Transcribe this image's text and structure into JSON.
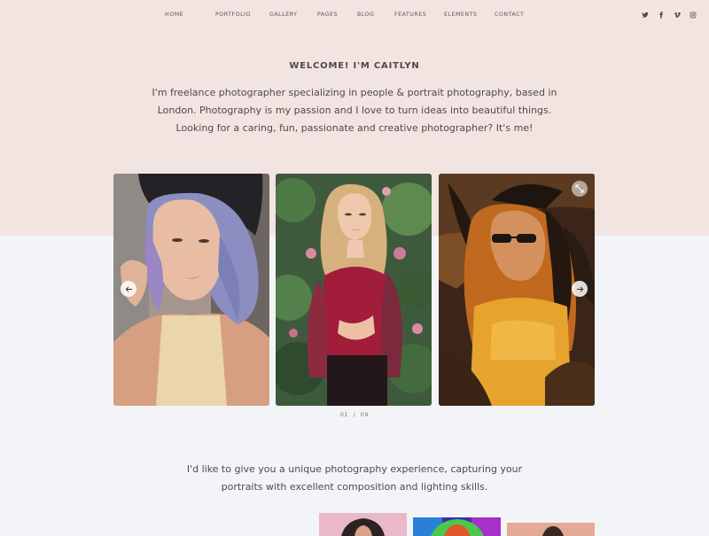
{
  "nav": {
    "items": [
      "HOME",
      "PORTFOLIO",
      "GALLERY",
      "PAGES",
      "BLOG",
      "FEATURES",
      "ELEMENTS",
      "CONTACT"
    ],
    "social": [
      "twitter-icon",
      "facebook-icon",
      "vimeo-icon",
      "instagram-icon"
    ]
  },
  "hero": {
    "welcome": "WELCOME! I'M CAITLYN",
    "intro": "I'm freelance photographer specializing in people & portrait photography, based in London. Photography is my passion and I love to turn ideas into beautiful things. Looking for a caring, fun, passionate and creative photographer? It's me!"
  },
  "slider": {
    "current": "01",
    "separator": "/",
    "total": "09",
    "prev_icon": "arrow-left-icon",
    "next_icon": "arrow-right-icon",
    "expand_icon": "expand-icon"
  },
  "experience": {
    "text": "I'd like to give you a unique photography experience, capturing your portraits with excellent composition and lighting skills."
  },
  "colors": {
    "hero_background": "#f2e4e1",
    "page_background": "#f3f4f8"
  }
}
